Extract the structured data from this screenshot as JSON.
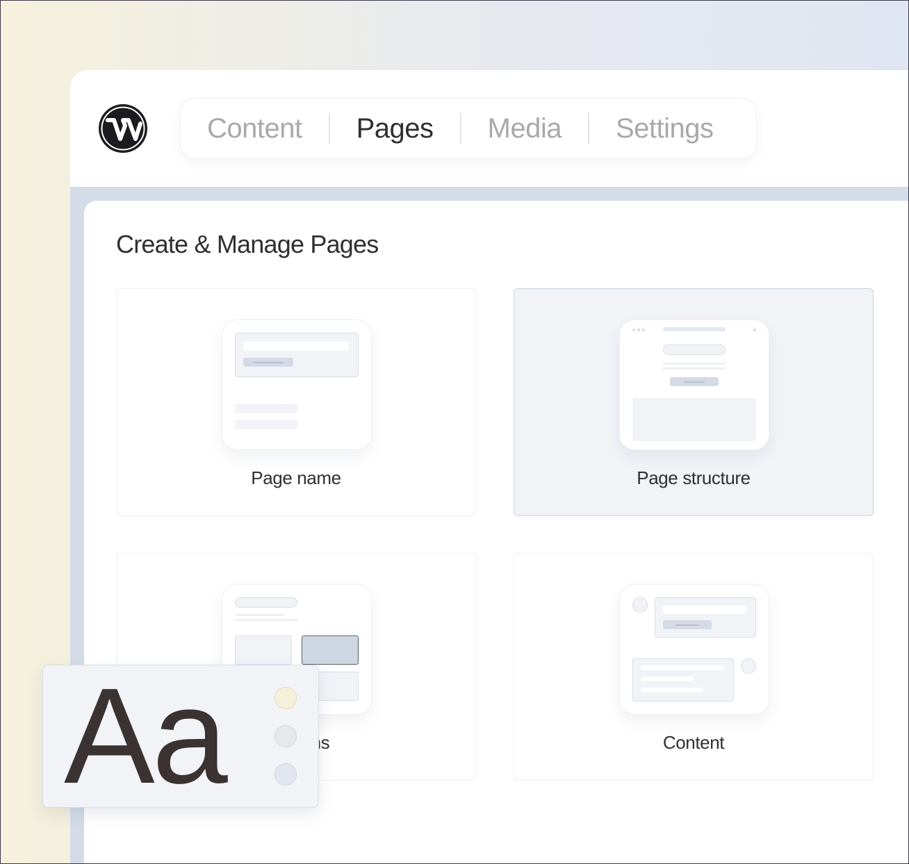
{
  "nav": {
    "tabs": [
      {
        "label": "Content",
        "active": false
      },
      {
        "label": "Pages",
        "active": true
      },
      {
        "label": "Media",
        "active": false
      },
      {
        "label": "Settings",
        "active": false
      }
    ]
  },
  "panel": {
    "title": "Create & Manage Pages",
    "cards": [
      {
        "label": "Page name",
        "selected": false
      },
      {
        "label": "Page structure",
        "selected": true
      },
      {
        "label": "Sections",
        "selected": false
      },
      {
        "label": "Content",
        "selected": false
      }
    ]
  },
  "typography": {
    "sample": "Aa",
    "swatches": [
      "#f4f1da",
      "#e6e8ec",
      "#e1e6f0"
    ]
  },
  "colors": {
    "accent_dark": "#2f2f33",
    "tab_inactive": "#a9a9a9",
    "content_bg": "#d4dce8",
    "selected_card_bg": "#f1f3f7"
  }
}
